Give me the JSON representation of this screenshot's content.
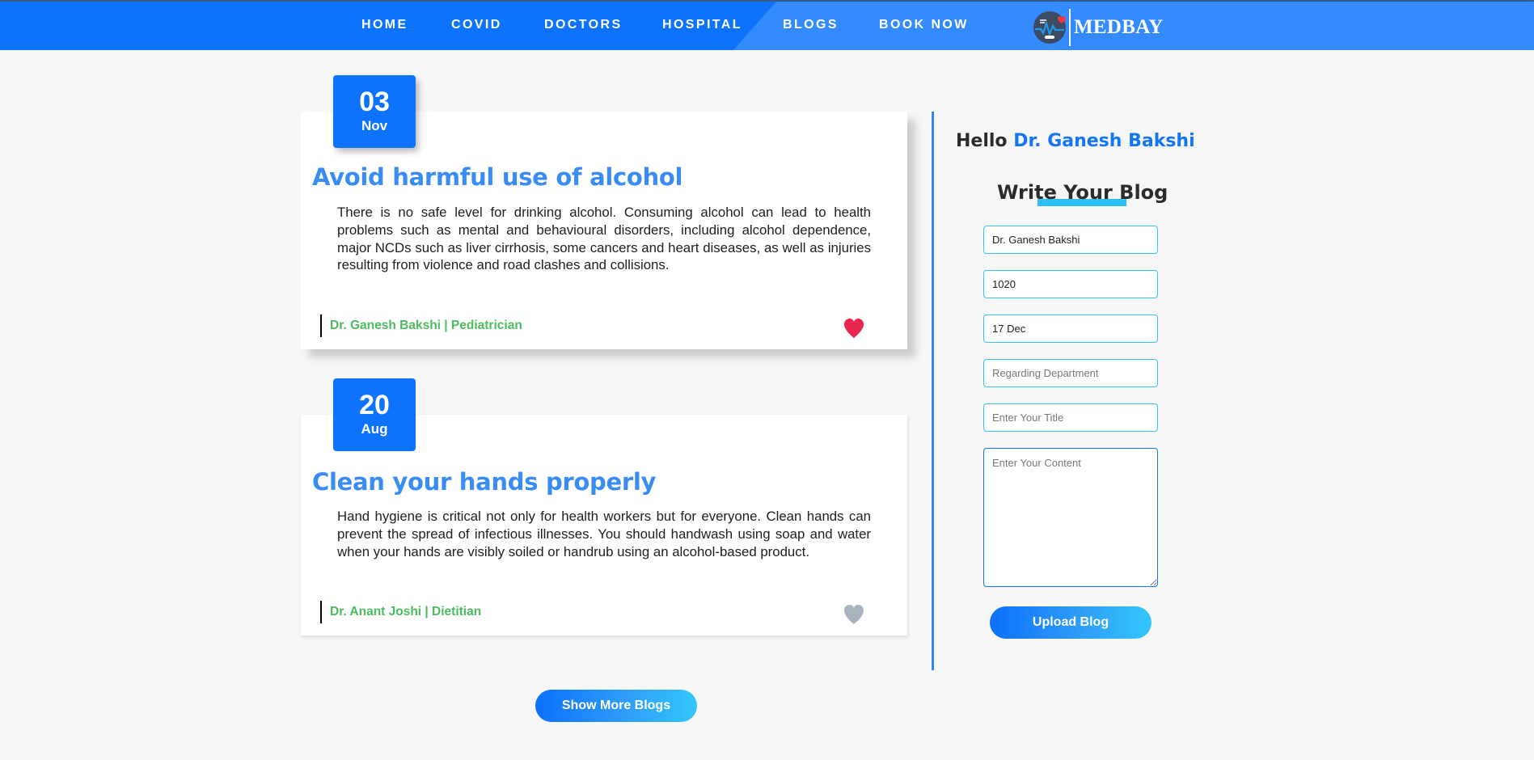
{
  "nav": {
    "items": [
      {
        "label": "HOME"
      },
      {
        "label": "COVID"
      },
      {
        "label": "DOCTORS"
      },
      {
        "label": "HOSPITAL"
      },
      {
        "label": "BLOGS",
        "active": true
      },
      {
        "label": "BOOK NOW"
      }
    ],
    "logo_text": "MEDBAY",
    "logo_icon": "heartbeat-monitor-icon"
  },
  "blogs": [
    {
      "day": "03",
      "month": "Nov",
      "title": "Avoid harmful use of alcohol",
      "body": "There is no safe level for drinking alcohol. Consuming alcohol can lead to health problems such as mental and behavioural disorders, including alcohol dependence, major NCDs such as liver cirrhosis, some cancers and heart diseases, as well as injuries resulting from violence and road clashes and collisions.",
      "author": "Dr. Ganesh Bakshi | Pediatrician",
      "liked": true,
      "heart_color": "#e8264f"
    },
    {
      "day": "20",
      "month": "Aug",
      "title": "Clean your hands properly",
      "body": "Hand hygiene is critical not only for health workers but for everyone. Clean hands can prevent the spread of infectious illnesses. You should handwash using soap and water when your hands are visibly soiled or handrub using an alcohol-based product.",
      "author": "Dr. Anant Joshi | Dietitian",
      "liked": false,
      "heart_color": "#a7b4bf"
    }
  ],
  "show_more_label": "Show More Blogs",
  "panel": {
    "hello_prefix": "Hello",
    "hello_name": "Dr. Ganesh Bakshi",
    "write_title": "Write Your Blog",
    "fields": [
      {
        "value": "Dr. Ganesh Bakshi",
        "placeholder": ""
      },
      {
        "value": "1020",
        "placeholder": ""
      },
      {
        "value": "17 Dec",
        "placeholder": ""
      },
      {
        "value": "",
        "placeholder": "Regarding Department"
      },
      {
        "value": "",
        "placeholder": "Enter Your Title"
      }
    ],
    "content_placeholder": "Enter Your Content",
    "upload_label": "Upload Blog"
  },
  "colors": {
    "primary": "#0d73fd",
    "nav_light": "#338bff",
    "title_blue": "#3a8cf5",
    "author_green": "#4cbb5e",
    "accent_cyan": "#2dc0f6"
  }
}
